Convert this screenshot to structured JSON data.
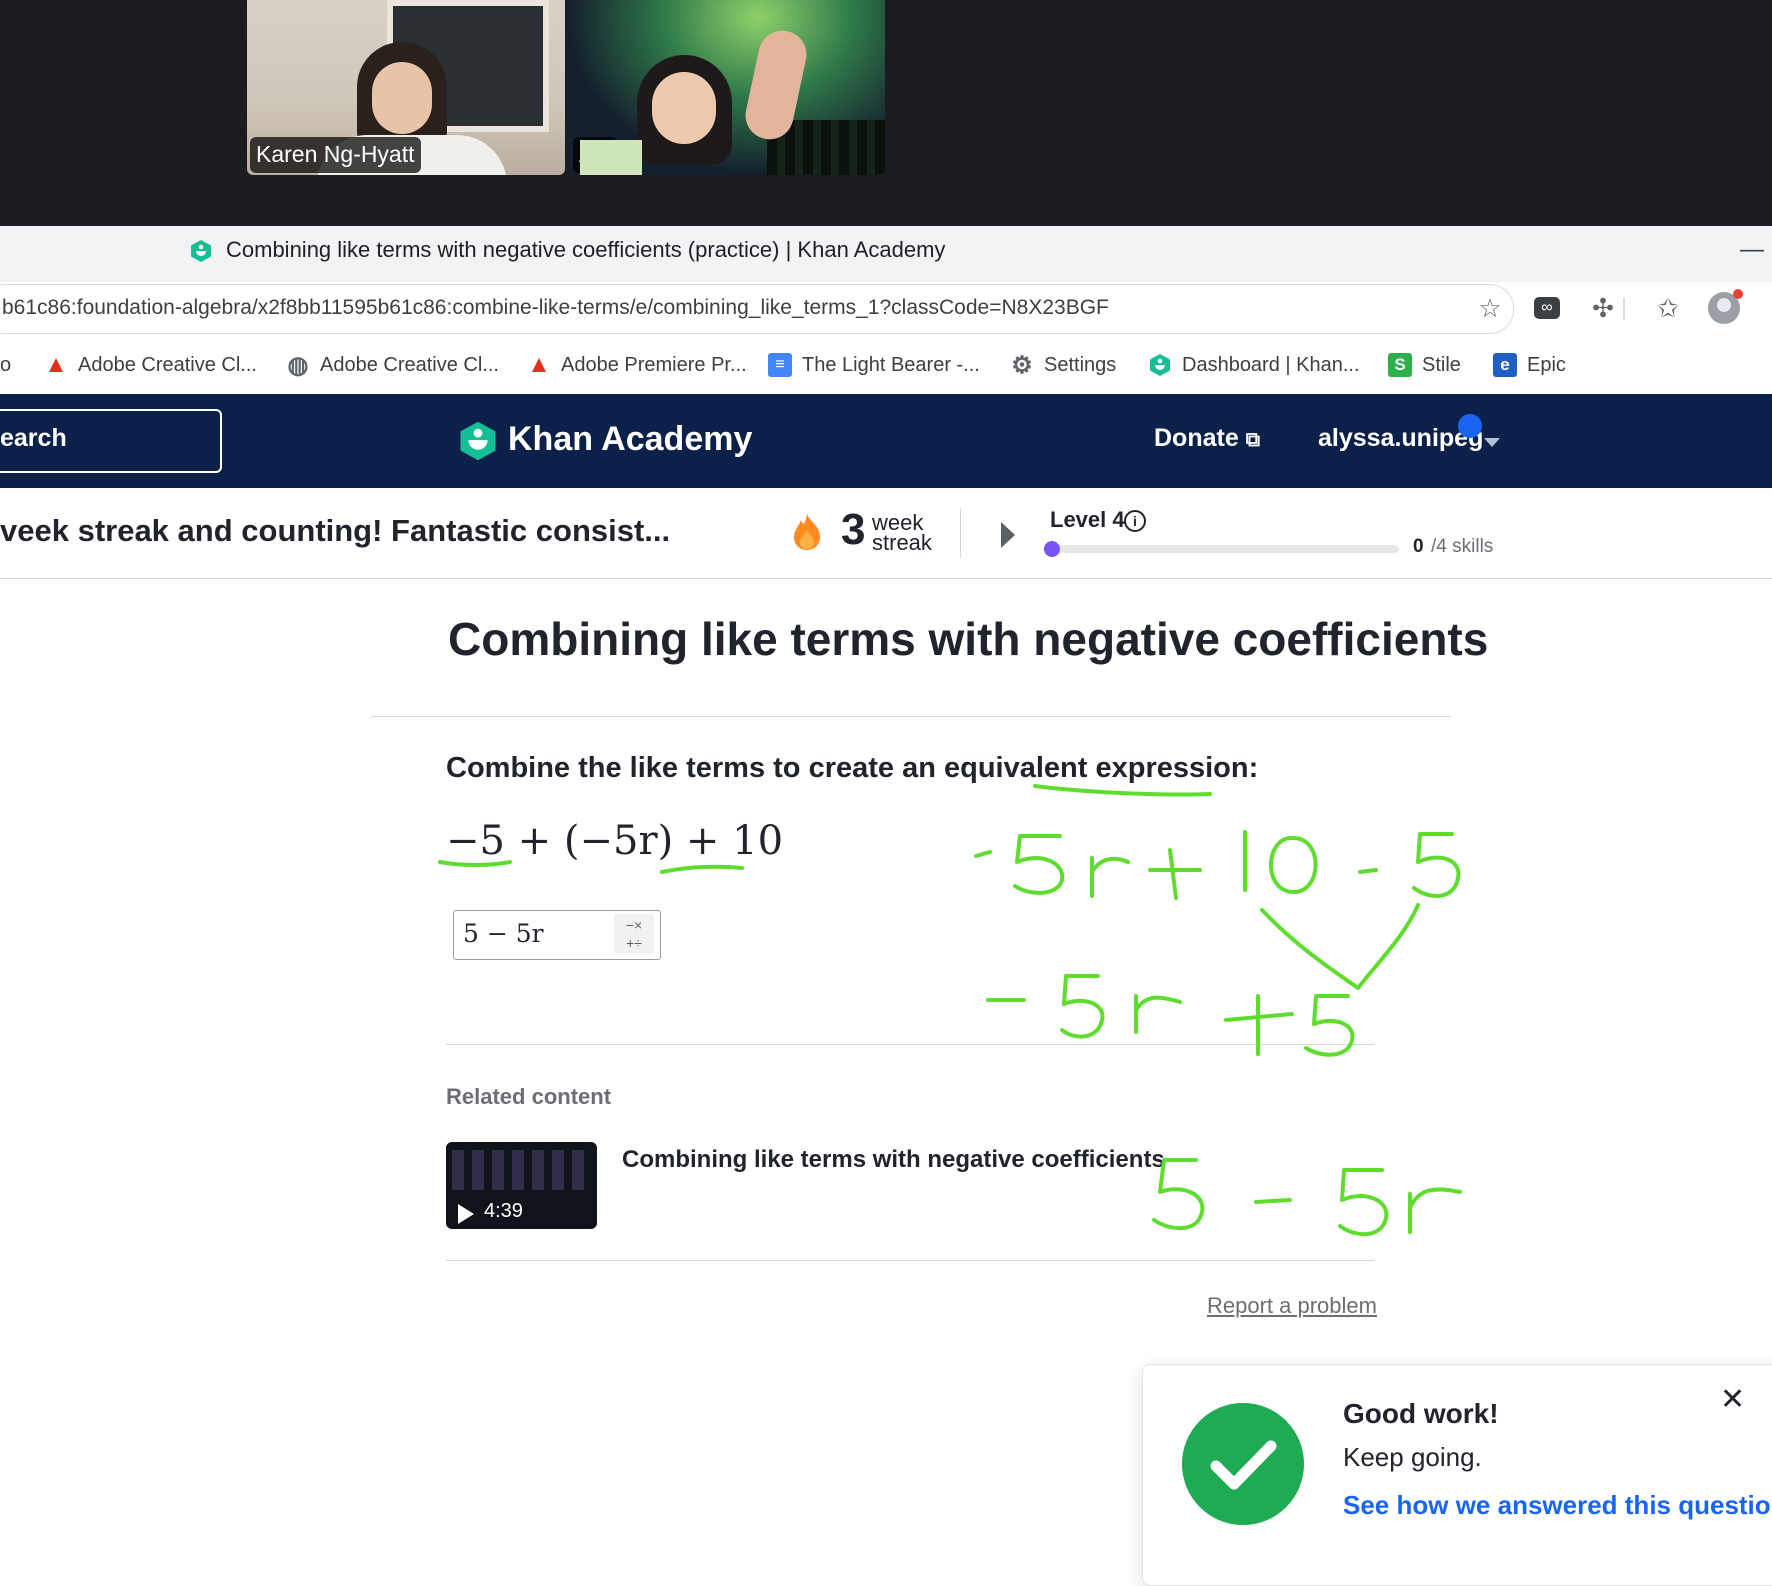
{
  "video_call": {
    "participants": [
      {
        "name": "Karen Ng-Hyatt"
      },
      {
        "name": "A     a"
      }
    ]
  },
  "browser": {
    "tab_title": "Combining like terms with negative coefficients (practice) | Khan Academy",
    "minimize_label": "—",
    "url": "b61c86:foundation-algebra/x2f8bb11595b61c86:combine-like-terms/e/combining_like_terms_1?classCode=N8X23BGF",
    "bookmarks": [
      {
        "label": "o",
        "icon": "none"
      },
      {
        "label": "Adobe Creative Cl...",
        "icon": "adobe-icon"
      },
      {
        "label": "Adobe Creative Cl...",
        "icon": "globe-icon"
      },
      {
        "label": "Adobe Premiere Pr...",
        "icon": "adobe-icon"
      },
      {
        "label": "The Light Bearer -...",
        "icon": "docs-icon"
      },
      {
        "label": "Settings",
        "icon": "gear-icon"
      },
      {
        "label": "Dashboard | Khan...",
        "icon": "khan-icon"
      },
      {
        "label": "Stile",
        "icon": "stile-icon"
      },
      {
        "label": "Epic",
        "icon": "epic-icon"
      }
    ],
    "toolbar_icons": [
      "star-icon",
      "infinity-extension-icon",
      "puzzle-extension-icon",
      "favorites-icon",
      "profile-icon"
    ]
  },
  "ka_header": {
    "search_text": "earch",
    "logo_text": "Khan Academy",
    "donate_label": "Donate",
    "username": "alyssa.unipeg",
    "brand_color": "#0b2149"
  },
  "streak_bar": {
    "message": "veek streak and counting! Fantastic consist...",
    "streak_count": "3",
    "streak_unit_line1": "week",
    "streak_unit_line2": "streak",
    "level_label": "Level 4",
    "level_info_glyph": "i",
    "skills_done": "0",
    "skills_total_text": "/4 skills",
    "progress_fraction": 0
  },
  "exercise": {
    "title": "Combining like terms with negative coefficients",
    "prompt": "Combine the like terms to create an equivalent expression:",
    "expression": "−5 + (−5r) + 10",
    "answer": "5 − 5r",
    "keypad_glyph_top": "−×",
    "keypad_glyph_bottom": "+÷"
  },
  "related": {
    "heading": "Related content",
    "video_title": "Combining like terms with negative coefficients",
    "video_duration": "4:39",
    "report_link": "Report a problem"
  },
  "toast": {
    "title": "Good work!",
    "body": "Keep going.",
    "link": "See how we answered this question.",
    "close_glyph": "✕",
    "success_color": "#1fab54"
  },
  "handwriting": {
    "line1": "-5r + 10 - 5",
    "line2": "-5r +5",
    "line3": "5 - 5r",
    "ink_color": "#5fdd2e"
  }
}
